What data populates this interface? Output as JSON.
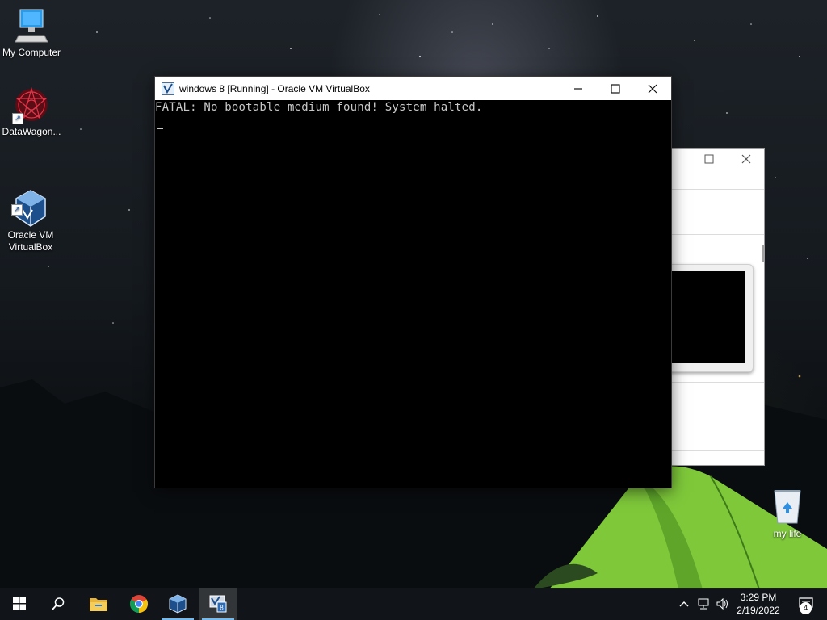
{
  "desktop": {
    "icons": [
      {
        "label": "My Computer",
        "icon": "computer-icon"
      },
      {
        "label": "DataWagon...",
        "icon": "datawagon-app-icon"
      },
      {
        "label": "Oracle VM\nVirtualBox",
        "icon": "virtualbox-icon"
      },
      {
        "label": "my life",
        "icon": "recycle-bin-icon"
      }
    ]
  },
  "vm_window": {
    "title": "windows 8 [Running] - Oracle VM VirtualBox",
    "icon": "virtualbox-icon",
    "controls": {
      "minimize": "minimize-icon",
      "maximize": "maximize-icon",
      "close": "close-icon"
    },
    "screen": {
      "message": "FATAL: No bootable medium found! System halted.",
      "cursor": "_"
    }
  },
  "background_window": {
    "controls": {
      "maximize": "maximize-icon",
      "close": "close-icon"
    }
  },
  "taskbar": {
    "start": "windows-start-icon",
    "search": "search-icon",
    "pinned": [
      {
        "name": "file-explorer-icon"
      },
      {
        "name": "chrome-icon"
      },
      {
        "name": "virtualbox-icon"
      },
      {
        "name": "vm-session-icon"
      }
    ],
    "tray": {
      "chevron": "chevron-up-icon",
      "network": "network-icon",
      "volume": "volume-icon"
    },
    "clock": {
      "time": "3:29 PM",
      "date": "2/19/2022"
    },
    "notifications": {
      "icon": "notifications-icon",
      "count": "4"
    }
  },
  "colors": {
    "taskbar_bg": "#12161a",
    "vm_screen_bg": "#000000",
    "vm_text": "#c8c8c8",
    "accent": "#76b9ed",
    "tent_green": "#7ec83a"
  }
}
